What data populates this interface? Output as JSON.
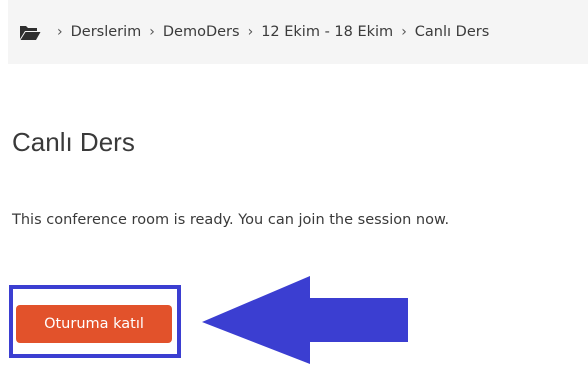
{
  "breadcrumb": {
    "folder_icon": "folder-open-icon",
    "items": [
      {
        "label": "Derslerim"
      },
      {
        "label": "DemoDers"
      },
      {
        "label": "12 Ekim - 18 Ekim"
      },
      {
        "label": "Canlı Ders"
      }
    ]
  },
  "main": {
    "title": "Canlı Ders",
    "status_message": "This conference room is ready. You can join the session now.",
    "join_button_label": "Oturuma katıl"
  },
  "annotation": {
    "highlight_color": "#3b3ed1",
    "arrow_icon": "left-arrow-icon"
  },
  "colors": {
    "button": "#e2522b",
    "breadcrumb_bg": "#f5f5f5"
  }
}
